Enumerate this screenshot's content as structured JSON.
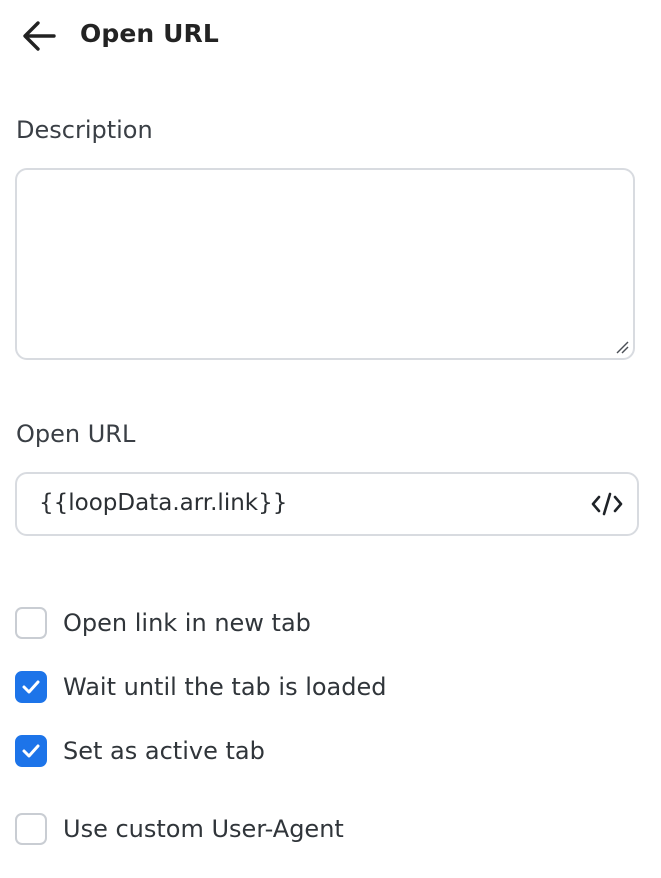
{
  "header": {
    "title": "Open URL"
  },
  "description": {
    "label": "Description",
    "value": ""
  },
  "url": {
    "label": "Open URL",
    "value": "{{loopData.arr.link}}"
  },
  "options": [
    {
      "label": "Open link in new tab",
      "checked": false
    },
    {
      "label": "Wait until the tab is loaded",
      "checked": true
    },
    {
      "label": "Set as active tab",
      "checked": true
    },
    {
      "label": "Use custom User-Agent",
      "checked": false
    }
  ],
  "colors": {
    "accent": "#1d74e9",
    "border": "#d8dbe0"
  },
  "icons": {
    "back": "arrow-left-icon",
    "code": "code-icon",
    "check": "check-icon",
    "resize": "resize-handle-icon"
  }
}
